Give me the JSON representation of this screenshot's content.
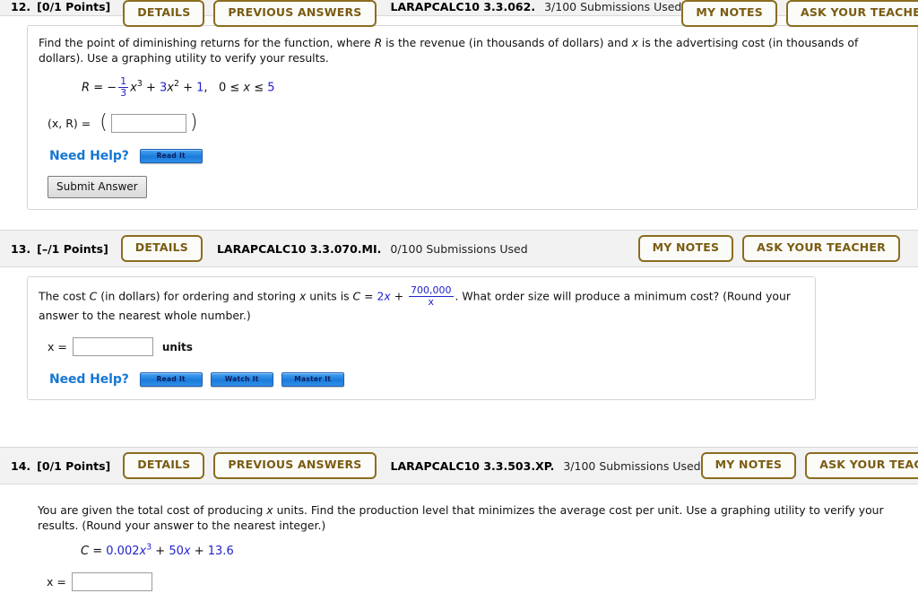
{
  "questions": [
    {
      "number": "12.",
      "points": "[0/1 Points]",
      "details_label": "DETAILS",
      "previous_answers_label": "PREVIOUS ANSWERS",
      "code": "LARAPCALC10 3.3.062.",
      "submissions": "3/100 Submissions Used",
      "my_notes_label": "MY NOTES",
      "ask_teacher_label": "ASK YOUR TEACHER",
      "prompt_part1": "Find the point of diminishing returns for the function, where ",
      "prompt_var1": "R",
      "prompt_part2": " is the revenue (in thousands of dollars) and ",
      "prompt_var2": "x",
      "prompt_part3": " is the advertising cost (in thousands of dollars). Use a graphing utility to verify your results.",
      "equation": {
        "lhs": "R",
        "eq": "=",
        "minus": "−",
        "frac_num": "1",
        "frac_den": "3",
        "term1_var": "x",
        "term1_exp": "3",
        "plus1": "+",
        "coef2": "3",
        "term2_var": "x",
        "term2_exp": "2",
        "plus2": "+",
        "const": "1",
        "comma": ",",
        "domain_lo": "0",
        "domain_le1": "≤",
        "domain_var": "x",
        "domain_le2": "≤",
        "domain_hi": "5"
      },
      "answer_label": "(x, R)  =",
      "answer_value": "",
      "paren_open": "(",
      "paren_close": ")",
      "need_help_label": "Need Help?",
      "help_buttons": [
        "Read It"
      ],
      "submit_label": "Submit Answer"
    },
    {
      "number": "13.",
      "points": "[–/1 Points]",
      "details_label": "DETAILS",
      "code": "LARAPCALC10 3.3.070.MI.",
      "submissions": "0/100 Submissions Used",
      "my_notes_label": "MY NOTES",
      "ask_teacher_label": "ASK YOUR TEACHER",
      "prompt_part1": "The cost ",
      "prompt_var1": "C",
      "prompt_part2": " (in dollars) for ordering and storing ",
      "prompt_var2": "x",
      "prompt_part3": " units is ",
      "eq_lhs": "C",
      "eq_sign": "=",
      "eq_coef": "2",
      "eq_var": "x",
      "eq_plus": "+",
      "frac_num": "700,000",
      "frac_den": "x",
      "prompt_part4": ". What order size will produce a minimum cost? (Round your answer to the nearest whole number.)",
      "answer_label": "x  =",
      "answer_value": "",
      "answer_units": "units",
      "need_help_label": "Need Help?",
      "help_buttons": [
        "Read It",
        "Watch It",
        "Master It"
      ]
    },
    {
      "number": "14.",
      "points": "[0/1 Points]",
      "details_label": "DETAILS",
      "previous_answers_label": "PREVIOUS ANSWERS",
      "code": "LARAPCALC10 3.3.503.XP.",
      "submissions": "3/100 Submissions Used",
      "my_notes_label": "MY NOTES",
      "ask_teacher_label": "ASK YOUR TEACHER",
      "prompt_part1": "You are given the total cost of producing ",
      "prompt_var1": "x",
      "prompt_part2": " units. Find the production level that minimizes the average cost per unit. Use a graphing utility to verify your results. (Round your answer to the nearest integer.)",
      "equation": {
        "lhs": "C",
        "eq": "=",
        "coef1": "0.002",
        "term1_var": "x",
        "term1_exp": "3",
        "plus1": "+",
        "coef2": "50",
        "term2_var": "x",
        "plus2": "+",
        "const": "13.6"
      },
      "answer_label": "x  =",
      "answer_value": ""
    }
  ],
  "colors": {
    "pill_border": "#8a6d1f",
    "pill_text": "#7a5c12",
    "math_blue": "#2222cc",
    "need_help_blue": "#1676d2",
    "header_band": "#f2f2f2"
  }
}
